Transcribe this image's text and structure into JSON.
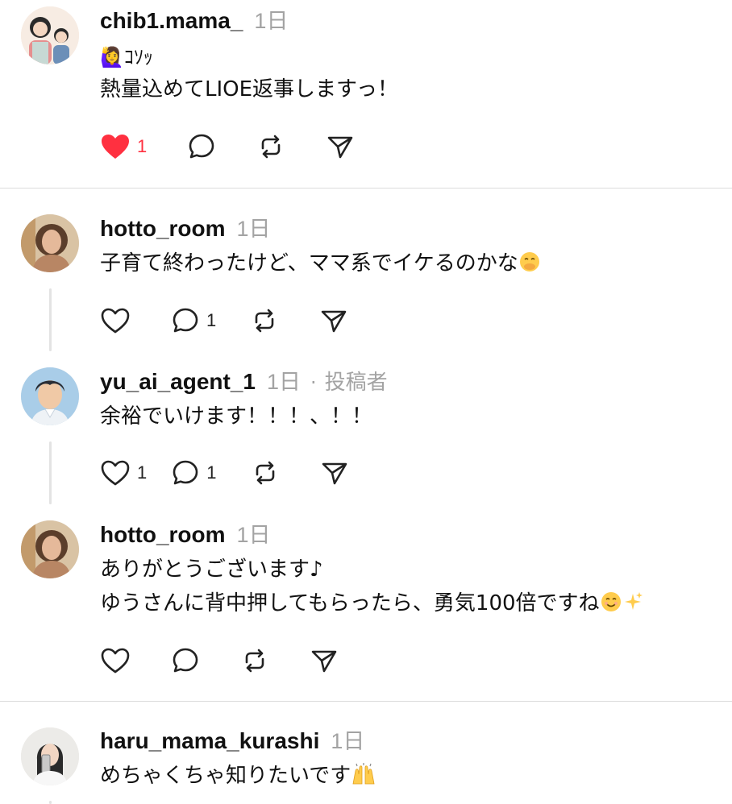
{
  "posts": [
    {
      "username": "chib1.mama_",
      "time": "1日",
      "lines": [
        "🙋‍♀️ｺｿｯ",
        "熱量込めてLIOE返事しますっ！"
      ],
      "likes": "1",
      "liked": true,
      "replies": "",
      "reposts": ""
    },
    {
      "username": "hotto_room",
      "time": "1日",
      "lines": [
        "子育て終わったけど、ママ系でイケるのかな"
      ],
      "likes": "",
      "replies": "1"
    },
    {
      "username": "yu_ai_agent_1",
      "time": "1日",
      "author_badge": "投稿者",
      "separator": "·",
      "lines": [
        "余裕でいけます！！！、！！"
      ],
      "likes": "1",
      "replies": "1"
    },
    {
      "username": "hotto_room",
      "time": "1日",
      "lines": [
        "ありがとうございます♪",
        "ゆうさんに背中押してもらったら、勇気100倍ですね"
      ],
      "likes": "",
      "replies": ""
    },
    {
      "username": "haru_mama_kurashi",
      "time": "1日",
      "lines": [
        "めちゃくちゃ知りたいです"
      ]
    }
  ],
  "icons": {
    "like": "heart-icon",
    "reply": "comment-bubble-icon",
    "repost": "repost-icon",
    "share": "send-icon"
  },
  "colors": {
    "like_active": "#ff3040",
    "muted_text": "#a3a3a3",
    "divider": "#dcdcdc"
  }
}
